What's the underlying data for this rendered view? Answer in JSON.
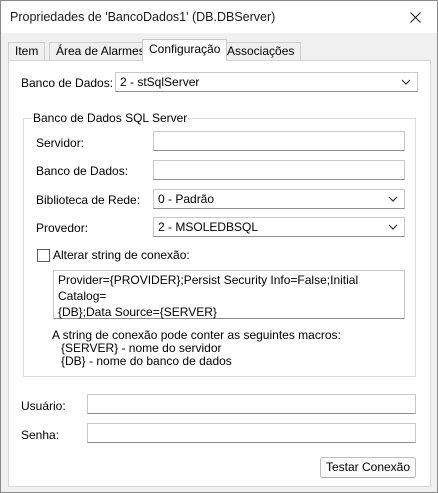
{
  "window": {
    "title": "Propriedades de 'BancoDados1' (DB.DBServer)"
  },
  "tabs": [
    {
      "label": "Item"
    },
    {
      "label": "Área de Alarmes"
    },
    {
      "label": "Configuração"
    },
    {
      "label": "Associações"
    }
  ],
  "form": {
    "database_label": "Banco de Dados:",
    "database_value": "2 - stSqlServer",
    "group_title": "Banco de Dados SQL Server",
    "server_label": "Servidor:",
    "server_value": "",
    "db_name_label": "Banco de Dados:",
    "db_name_value": "",
    "network_lib_label": "Biblioteca de Rede:",
    "network_lib_value": "0 - Padrão",
    "provider_label": "Provedor:",
    "provider_value": "2 - MSOLEDBSQL",
    "alter_conn_label": "Alterar string de conexão:",
    "alter_conn_checked": false,
    "conn_string_line1": "Provider={PROVIDER};Persist Security Info=False;Initial Catalog=",
    "conn_string_line2": "{DB};Data Source={SERVER}",
    "macros_intro": "A string de conexão pode conter as seguintes macros:",
    "macro_server": "{SERVER} - nome do servidor",
    "macro_db": "{DB} - nome do banco de dados",
    "user_label": "Usuário:",
    "user_value": "",
    "password_label": "Senha:",
    "password_value": "",
    "test_button": "Testar Conexão"
  },
  "icons": {
    "close": "close-icon",
    "dropdown": "chevron-down-icon"
  }
}
